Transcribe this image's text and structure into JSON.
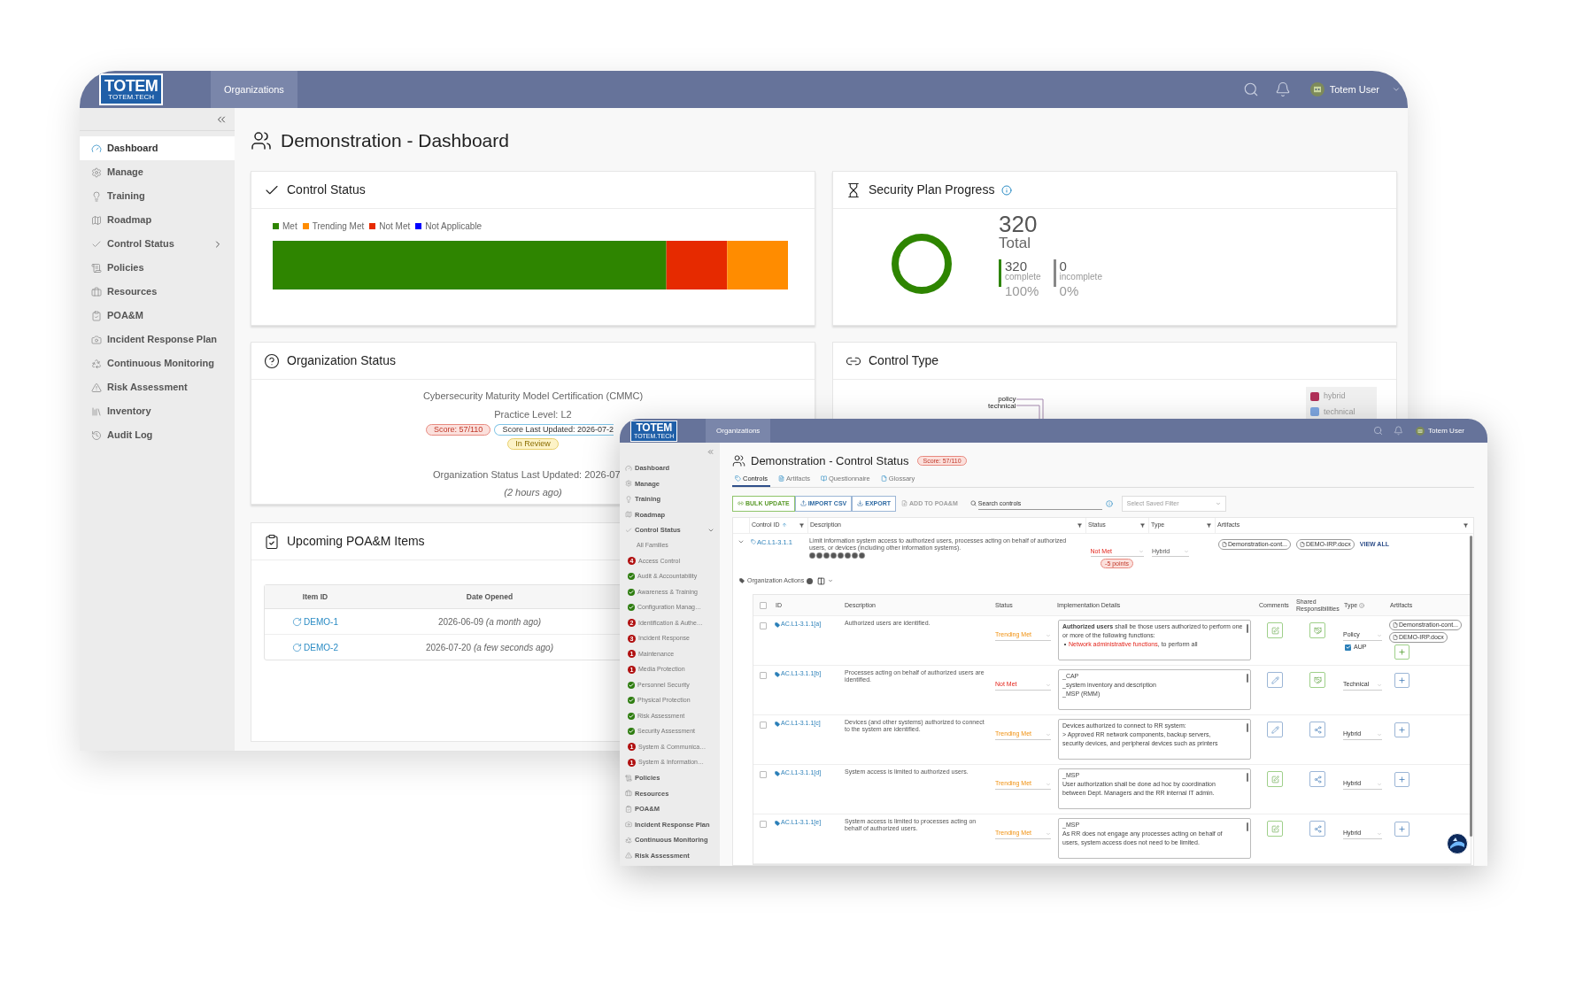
{
  "back_window": {
    "header": {
      "logo": "TOTEM",
      "logo_sub": "TOTEM.TECH",
      "tab": "Organizations",
      "user": "Totem User"
    },
    "sidebar": [
      {
        "label": "Dashboard",
        "kind": "link",
        "selected": true
      },
      {
        "label": "Manage",
        "kind": "link",
        "selected": false
      },
      {
        "label": "Training",
        "kind": "link",
        "selected": false
      },
      {
        "label": "Roadmap",
        "kind": "link",
        "selected": false
      },
      {
        "label": "Control Status",
        "kind": "group",
        "selected": false,
        "expanded": false
      },
      {
        "label": "Policies",
        "kind": "link",
        "selected": false
      },
      {
        "label": "Resources",
        "kind": "link",
        "selected": false
      },
      {
        "label": "POA&M",
        "kind": "link",
        "selected": false
      },
      {
        "label": "Incident Response Plan",
        "kind": "link",
        "selected": false
      },
      {
        "label": "Continuous Monitoring",
        "kind": "link",
        "selected": false
      },
      {
        "label": "Risk Assessment",
        "kind": "link",
        "selected": false
      },
      {
        "label": "Inventory",
        "kind": "link",
        "selected": false
      },
      {
        "label": "Audit Log",
        "kind": "link",
        "selected": false
      }
    ],
    "title": "Demonstration - Dashboard",
    "control_status": {
      "title": "Control Status",
      "legend": [
        {
          "label": "Met",
          "color": "#2e8500"
        },
        {
          "label": "Trending Met",
          "color": "#ff8c00"
        },
        {
          "label": "Not Met",
          "color": "#e62a00"
        },
        {
          "label": "Not Applicable",
          "color": "#0000ff"
        }
      ]
    },
    "security_plan": {
      "title": "Security Plan Progress",
      "total": "320",
      "total_label": "Total",
      "stats": [
        {
          "kind": "complete",
          "value": "320",
          "label": "complete",
          "percent": "100%"
        },
        {
          "kind": "incomplete",
          "value": "0",
          "label": "incomplete",
          "percent": "0%"
        }
      ]
    },
    "organization_status": {
      "title": "Organization Status",
      "framework": "Cybersecurity Maturity Model Certification (CMMC)",
      "practice_level": "Practice Level: L2",
      "score": "Score: 57/110",
      "score_updated": "Score Last Updated: 2026-07-2",
      "review": "In Review",
      "last_updated": "Organization Status Last Updated: 2026-07",
      "ago": "(2 hours ago)"
    },
    "control_type": {
      "title": "Control Type",
      "chart_labels": [
        "policy",
        "technical"
      ],
      "legend": [
        {
          "label": "hybrid",
          "color": "#b03058"
        },
        {
          "label": "technical",
          "color": "#7ea6e0"
        }
      ]
    },
    "poam": {
      "title": "Upcoming POA&M Items",
      "columns": [
        "Item ID",
        "Date Opened"
      ],
      "rows": [
        {
          "id": "DEMO-1",
          "date": "2026-06-09 *(a month ago)*"
        },
        {
          "id": "DEMO-2",
          "date": "2026-07-20 *(a few seconds ago)*"
        }
      ]
    }
  },
  "front_window": {
    "header": {
      "logo": "TOTEM",
      "logo_sub": "TOTEM.TECH",
      "tab": "Organizations",
      "user": "Totem User"
    },
    "sidebar": [
      {
        "label": "Dashboard",
        "kind": "link",
        "selected": false
      },
      {
        "label": "Manage",
        "kind": "link",
        "selected": false
      },
      {
        "label": "Training",
        "kind": "link",
        "selected": false
      },
      {
        "label": "Roadmap",
        "kind": "link",
        "selected": false
      },
      {
        "label": "Control Status",
        "kind": "group",
        "selected": false,
        "expanded": true,
        "children": [
          {
            "label": "All Families",
            "kind": "all"
          },
          {
            "label": "Access Control",
            "kind": "not_met",
            "count": "4"
          },
          {
            "label": "Audit & Accountability",
            "kind": "met"
          },
          {
            "label": "Awareness & Training",
            "kind": "met"
          },
          {
            "label": "Configuration Manag…",
            "kind": "met"
          },
          {
            "label": "Identification & Authe…",
            "kind": "not_met",
            "count": "2"
          },
          {
            "label": "Incident Response",
            "kind": "not_met",
            "count": "3"
          },
          {
            "label": "Maintenance",
            "kind": "not_met",
            "count": "1"
          },
          {
            "label": "Media Protection",
            "kind": "not_met",
            "count": "1"
          },
          {
            "label": "Personnel Security",
            "kind": "met"
          },
          {
            "label": "Physical Protection",
            "kind": "met"
          },
          {
            "label": "Risk Assessment",
            "kind": "met"
          },
          {
            "label": "Security Assessment",
            "kind": "met"
          },
          {
            "label": "System & Communica…",
            "kind": "not_met",
            "count": "1"
          },
          {
            "label": "System & Information…",
            "kind": "not_met",
            "count": "1"
          }
        ]
      },
      {
        "label": "Policies",
        "kind": "link",
        "selected": false
      },
      {
        "label": "Resources",
        "kind": "link",
        "selected": false
      },
      {
        "label": "POA&M",
        "kind": "link",
        "selected": false
      },
      {
        "label": "Incident Response Plan",
        "kind": "link",
        "selected": false
      },
      {
        "label": "Continuous Monitoring",
        "kind": "link",
        "selected": false
      },
      {
        "label": "Risk Assessment",
        "kind": "link",
        "selected": false
      }
    ],
    "title": "Demonstration - Control Status",
    "score": "Score: 57/110",
    "tabs": [
      {
        "label": "Controls",
        "selected": true
      },
      {
        "label": "Artifacts",
        "selected": false
      },
      {
        "label": "Questionnaire",
        "selected": false
      },
      {
        "label": "Glossary",
        "selected": false
      }
    ],
    "toolbar": [
      {
        "label": "BULK UPDATE",
        "kind": "bulk",
        "disabled": false
      },
      {
        "label": "IMPORT CSV",
        "kind": "import",
        "disabled": false
      },
      {
        "label": "EXPORT",
        "kind": "export",
        "disabled": false
      },
      {
        "label": "ADD TO POA&M",
        "kind": "poam",
        "disabled": true
      }
    ],
    "search": {
      "placeholder": "Search controls"
    },
    "saved_filter": {
      "placeholder": "Select Saved Filter"
    },
    "columns": [
      "Control ID",
      "Description",
      "Status",
      "Type",
      "Artifacts"
    ],
    "control": {
      "id": "AC.L1-3.1.1",
      "expanded": true,
      "description": "Limit information system access to authorized users, processes acting on behalf of authorized users, or devices (including other information systems).",
      "status": {
        "text": "Not Met",
        "kind": "not_met"
      },
      "points": "-5 points",
      "type": "Hybrid",
      "artifacts": [
        "Demonstration-cont...",
        "DEMO-IRP.docx"
      ],
      "view_all": "VIEW ALL"
    },
    "organization_actions": "Organization Actions",
    "select_all": {
      "checked": false
    },
    "sub_columns": [
      "ID",
      "Description",
      "Status",
      "Implementation Details",
      "Comments",
      "Shared Responsibilities",
      "Type",
      "Artifacts"
    ],
    "objectives": [
      {
        "id": "AC.L1-3.1.1[a]",
        "checked": false,
        "description": "Authorized users are identified.",
        "status": {
          "text": "Trending Met",
          "kind": "trending"
        },
        "details": [
          {
            "kind": "text",
            "text": "**Authorized users** shall be those users authorized to perform one or more of the following functions:"
          },
          {
            "kind": "bullet",
            "link": "Network administrative functions",
            "text": ", to perform all"
          }
        ],
        "comment": {
          "kind": "note"
        },
        "shared": {
          "kind": "hand"
        },
        "type": "Policy",
        "aup": {
          "label": "AUP",
          "checked": true
        },
        "artifacts": [
          "Demonstration-cont...",
          "DEMO-IRP.docx"
        ]
      },
      {
        "id": "AC.L1-3.1.1[b]",
        "checked": false,
        "description": "Processes acting on behalf of authorized users are identified.",
        "status": {
          "text": "Not Met",
          "kind": "not_met"
        },
        "details": [
          {
            "kind": "text",
            "text": "_CAP"
          },
          {
            "kind": "text",
            "text": "_system inventory and description"
          },
          {
            "kind": "text",
            "text": "_MSP (RMM)"
          }
        ],
        "comment": {
          "kind": "pencil"
        },
        "shared": {
          "kind": "hand"
        },
        "type": "Technical"
      },
      {
        "id": "AC.L1-3.1.1[c]",
        "checked": false,
        "description": "Devices (and other systems) authorized to connect to the system are identified.",
        "status": {
          "text": "Trending Met",
          "kind": "trending"
        },
        "details": [
          {
            "kind": "text",
            "text": "Devices authorized to connect to RR system:"
          },
          {
            "kind": "text",
            "text": "> Approved RR network components, backup servers,"
          },
          {
            "kind": "text",
            "text": "security devices, and peripheral devices such as printers"
          }
        ],
        "comment": {
          "kind": "pencil"
        },
        "shared": {
          "kind": "share"
        },
        "type": "Hybrid"
      },
      {
        "id": "AC.L1-3.1.1[d]",
        "checked": false,
        "description": "System access is limited to authorized users.",
        "status": {
          "text": "Trending Met",
          "kind": "trending"
        },
        "details": [
          {
            "kind": "text",
            "text": "_MSP"
          },
          {
            "kind": "text",
            "text": "User authorization shall be done ad hoc by coordination"
          },
          {
            "kind": "text",
            "text": "between Dept. Managers and the RR internal IT admin."
          }
        ],
        "comment": {
          "kind": "note"
        },
        "shared": {
          "kind": "share"
        },
        "type": "Hybrid"
      },
      {
        "id": "AC.L1-3.1.1[e]",
        "checked": false,
        "description": "System access is limited to processes acting on behalf of authorized users.",
        "status": {
          "text": "Trending Met",
          "kind": "trending"
        },
        "details": [
          {
            "kind": "text",
            "text": "_MSP"
          },
          {
            "kind": "text",
            "text": "As RR does not engage any processes acting on behalf of"
          },
          {
            "kind": "text",
            "text": "users, system access does not need to be limited."
          }
        ],
        "comment": {
          "kind": "note"
        },
        "shared": {
          "kind": "share"
        },
        "type": "Hybrid"
      }
    ]
  }
}
